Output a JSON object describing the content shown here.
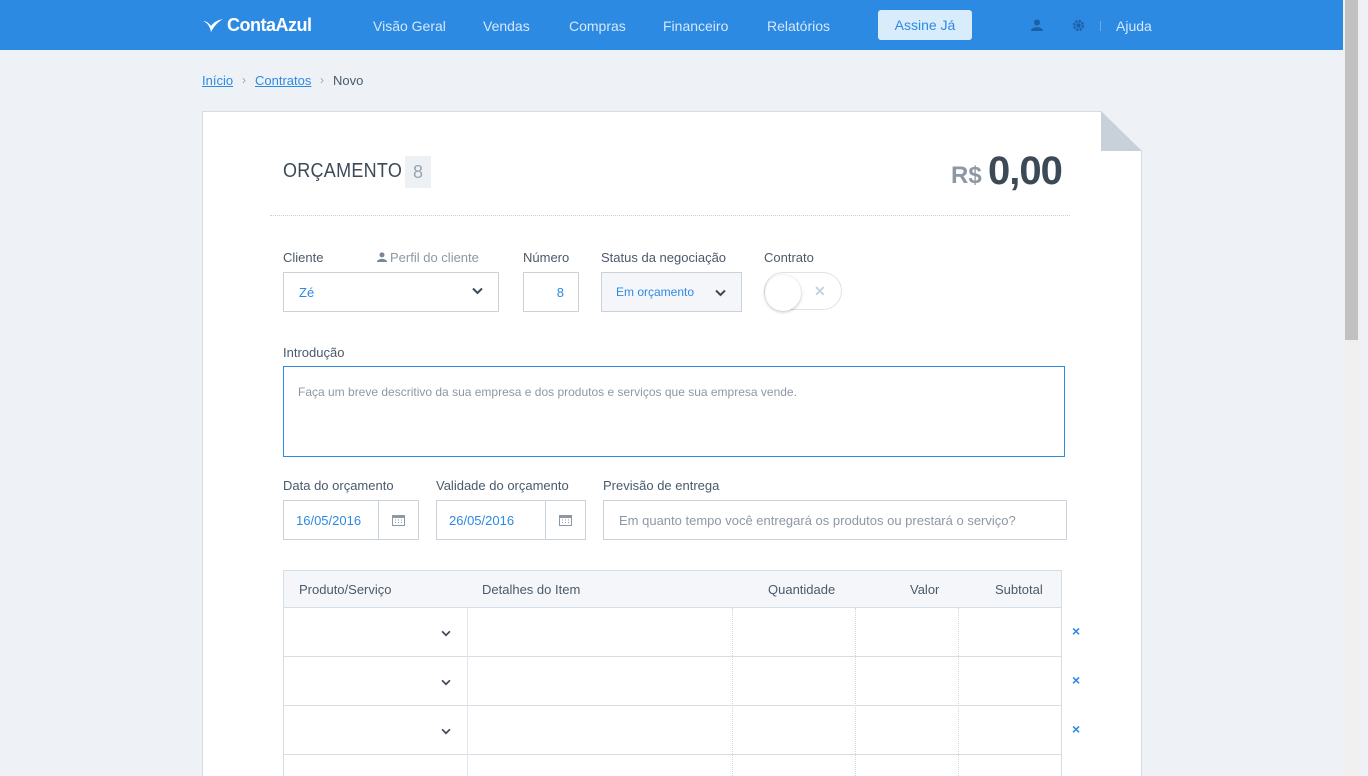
{
  "app": {
    "brand": "ContaAzul",
    "accent": "#2d8ae3"
  },
  "nav": {
    "items": [
      "Visão Geral",
      "Vendas",
      "Compras",
      "Financeiro",
      "Relatórios"
    ],
    "cta": "Assine Já",
    "user_icon": "user-icon",
    "settings_icon": "gear-icon",
    "help": "Ajuda"
  },
  "breadcrumb": {
    "home": "Início",
    "section": "Contratos",
    "current": "Novo",
    "separator": "›"
  },
  "doc": {
    "title": "ORÇAMENTO",
    "number": "8",
    "currency": "R$",
    "total": "0,00"
  },
  "form": {
    "cliente": {
      "label": "Cliente",
      "profile_link": "Perfil do cliente",
      "value": "Zé"
    },
    "numero": {
      "label": "Número",
      "value": "8"
    },
    "status": {
      "label": "Status da negociação",
      "value": "Em orçamento"
    },
    "contrato": {
      "label": "Contrato",
      "enabled": false,
      "off_glyph": "✕"
    },
    "introducao": {
      "label": "Introdução",
      "placeholder": "Faça um breve descritivo da sua empresa e dos produtos e serviços que sua empresa vende."
    },
    "data": {
      "label": "Data do orçamento",
      "value": "16/05/2016"
    },
    "validade": {
      "label": "Validade do orçamento",
      "value": "26/05/2016"
    },
    "previsao": {
      "label": "Previsão de entrega",
      "placeholder": "Em quanto tempo você entregará os produtos ou prestará o serviço?"
    }
  },
  "table": {
    "columns": [
      "Produto/Serviço",
      "Detalhes do Item",
      "Quantidade",
      "Valor",
      "Subtotal"
    ],
    "remove_glyph": "×",
    "rows": [
      {},
      {},
      {}
    ]
  }
}
